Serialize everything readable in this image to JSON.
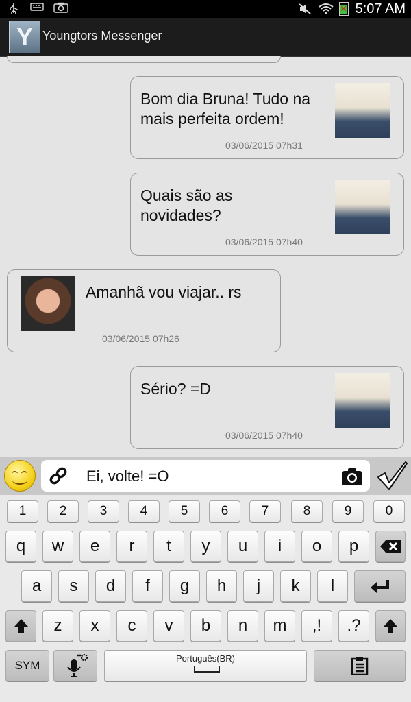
{
  "status_bar": {
    "time": "5:07 AM",
    "left_icons": [
      "usb-icon",
      "keyboard-icon",
      "camera-icon"
    ],
    "right_icons": [
      "mute-icon",
      "wifi-icon",
      "battery-icon"
    ]
  },
  "app": {
    "logo_letter": "Y",
    "title": "Youngtors Messenger"
  },
  "messages": [
    {
      "side": "right",
      "text": "Bom dia Bruna! Tudo na mais perfeita ordem!",
      "time": "03/06/2015 07h31",
      "avatar": "male-avatar"
    },
    {
      "side": "right",
      "text": "Quais são as novidades?",
      "time": "03/06/2015 07h40",
      "avatar": "male-avatar"
    },
    {
      "side": "left",
      "text": "Amanhã vou viajar.. rs",
      "time": "03/06/2015 07h26",
      "avatar": "female-avatar"
    },
    {
      "side": "right",
      "text": "Sério? =D",
      "time": "03/06/2015 07h40",
      "avatar": "male-avatar"
    }
  ],
  "composer": {
    "value": "Ei, volte! =O",
    "emoji_icon": "smiley-icon",
    "attach_icon": "link-icon",
    "camera_icon": "camera-icon",
    "send_icon": "checkmark-icon"
  },
  "keyboard": {
    "row_numbers": [
      "1",
      "2",
      "3",
      "4",
      "5",
      "6",
      "7",
      "8",
      "9",
      "0"
    ],
    "row1": [
      "q",
      "w",
      "e",
      "r",
      "t",
      "y",
      "u",
      "i",
      "o",
      "p"
    ],
    "row2": [
      "a",
      "s",
      "d",
      "f",
      "g",
      "h",
      "j",
      "k",
      "l"
    ],
    "row3": [
      "z",
      "x",
      "c",
      "v",
      "b",
      "n",
      "m",
      ",!",
      ".?"
    ],
    "sym_label": "SYM",
    "space_language": "Português(BR)",
    "icons": {
      "backspace": "backspace-icon",
      "enter": "enter-icon",
      "shift": "shift-icon",
      "mic": "microphone-settings-icon",
      "clipboard": "clipboard-icon"
    }
  }
}
